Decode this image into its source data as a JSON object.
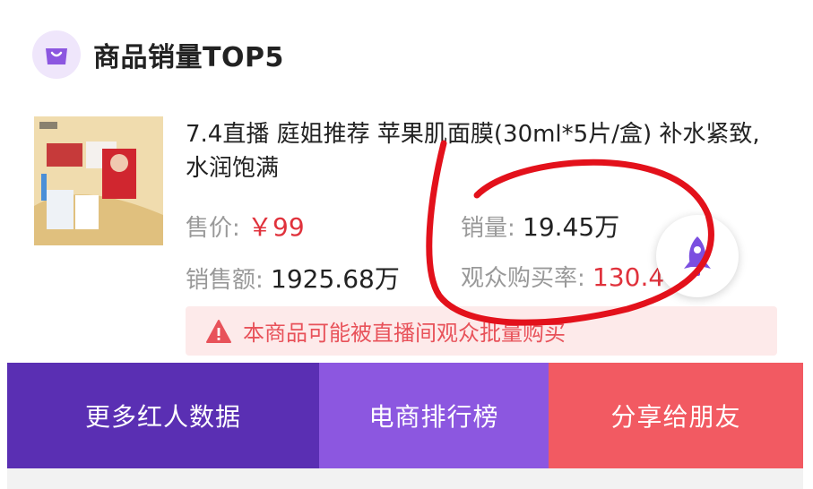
{
  "header": {
    "title": "商品销量TOP5",
    "icon": "shopping-bag-icon"
  },
  "product": {
    "title": "7.4直播 庭姐推荐 苹果肌面膜(30ml*5片/盒) 补水紧致,水润饱满",
    "price_label": "售价:",
    "price_value": "￥99",
    "sales_label": "销量:",
    "sales_value": "19.45万",
    "revenue_label": "销售额:",
    "revenue_value": "1925.68万",
    "conversion_label": "观众购买率:",
    "conversion_value": "130.4%"
  },
  "warning": {
    "text": "本商品可能被直播间观众批量购买",
    "icon": "warning-triangle-icon"
  },
  "floating_button": {
    "icon": "rocket-icon"
  },
  "bottom_buttons": [
    {
      "label": "更多红人数据"
    },
    {
      "label": "电商排行榜"
    },
    {
      "label": "分享给朋友"
    }
  ],
  "colors": {
    "accent_purple": "#8c57e0",
    "dark_purple": "#5a2fb3",
    "red": "#f25a62",
    "price_red": "#e0323c",
    "warning_bg": "#fdeaea",
    "annotation_red": "#e3111b"
  }
}
